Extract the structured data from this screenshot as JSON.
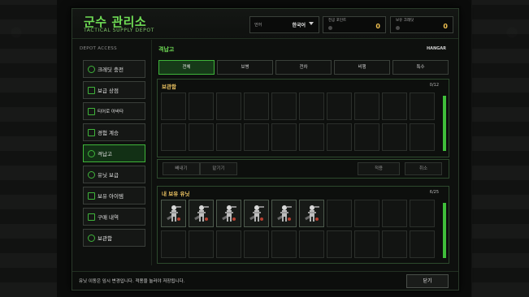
{
  "header": {
    "title": "군수 관리소",
    "subtitle": "TACTICAL SUPPLY DEPOT",
    "language": {
      "label": "언어",
      "value": "한국어"
    },
    "stats": [
      {
        "label": "전공 포인트",
        "value": "0"
      },
      {
        "label": "보유 크레딧",
        "value": "0"
      }
    ]
  },
  "sidebar": {
    "heading": "DEPOT ACCESS",
    "items": [
      {
        "label": "크레딧 충전",
        "icon": "credit-icon"
      },
      {
        "label": "보급 상점",
        "icon": "shop-icon"
      },
      {
        "label": "티어로 아바타",
        "icon": "avatar-icon"
      },
      {
        "label": "경험 계승",
        "icon": "experience-icon"
      },
      {
        "label": "격납고",
        "icon": "hangar-icon",
        "active": true
      },
      {
        "label": "유닛 보급",
        "icon": "unit-supply-icon"
      },
      {
        "label": "보유 아이템",
        "icon": "items-icon"
      },
      {
        "label": "구매 내역",
        "icon": "history-icon"
      },
      {
        "label": "보관함",
        "icon": "storage-icon"
      }
    ]
  },
  "main": {
    "title": "격납고",
    "badge": "HANGAR",
    "tabs": [
      {
        "label": "전체",
        "active": true
      },
      {
        "label": "보병"
      },
      {
        "label": "전차"
      },
      {
        "label": "비행"
      },
      {
        "label": "특수"
      }
    ],
    "storage": {
      "title": "보관함",
      "count": "0/12"
    },
    "actions": {
      "withdraw": "빼내기",
      "deposit": "맡기기",
      "apply": "적용",
      "cancel": "취소"
    },
    "owned": {
      "title": "내 보유 유닛",
      "count": "6/25",
      "filled_slots": 6
    }
  },
  "footer": {
    "message": "유닛 이동은 임시 변경입니다. 적용을 눌러야 저장됩니다.",
    "close_label": "닫기"
  },
  "colors": {
    "accent_green": "#6fdc55",
    "gold": "#f0c050",
    "active_border": "#3fb43a"
  }
}
